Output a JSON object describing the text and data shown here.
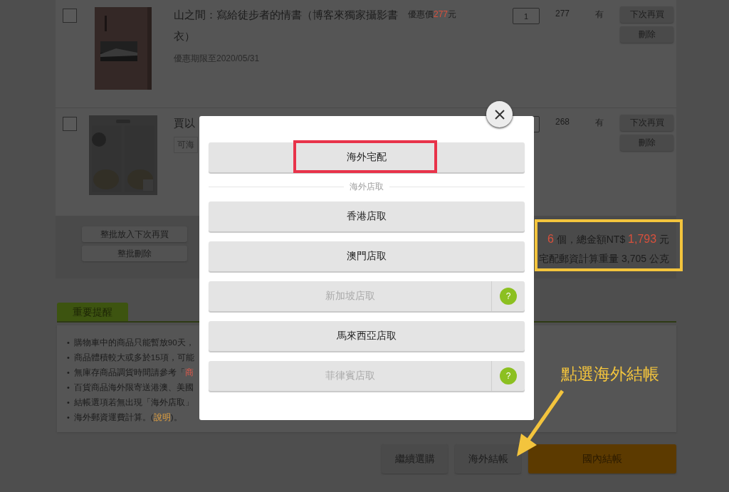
{
  "cart_items": [
    {
      "checked": false,
      "title": "山之間：寫給徒步者的情書（博客來獨家攝影書衣）",
      "note": "優惠期限至2020/05/31",
      "price_prefix": "優惠價",
      "price": "277",
      "price_suffix": "元",
      "quantity": "1",
      "subtotal": "277",
      "stock": "有",
      "actions": [
        "下次再買",
        "刪除"
      ]
    },
    {
      "checked": false,
      "title": "賈以",
      "tag": "可海",
      "subtotal": "268",
      "stock": "有",
      "actions": [
        "下次再買",
        "刪除"
      ]
    }
  ],
  "bulk_actions": [
    "整批放入下次再買",
    "整批刪除"
  ],
  "summary": {
    "line_1": [
      {
        "text": "6",
        "emphasis": true
      },
      {
        "text": " 個，總金額NT$ ",
        "emphasis": false
      },
      {
        "text": "1,793",
        "emphasis": true
      },
      {
        "text": " 元",
        "emphasis": false
      }
    ],
    "line_2": "宅配郵資計算重量 3,705 公克"
  },
  "notice": {
    "title": "重要提醒",
    "items": [
      {
        "bullet": "•",
        "parts": [
          {
            "kind": "text",
            "text": "購物車中的商品只能暫放90天，"
          }
        ]
      },
      {
        "bullet": "•",
        "parts": [
          {
            "kind": "text",
            "text": "商品體積較大或多於15項，可能"
          }
        ]
      },
      {
        "bullet": "•",
        "parts": [
          {
            "kind": "text",
            "text": "無庫存商品調貨時間請參考「"
          },
          {
            "kind": "link",
            "text": "商"
          }
        ]
      },
      {
        "bullet": "•",
        "parts": [
          {
            "kind": "text",
            "text": "百貨商品海外限寄送港澳、美國"
          }
        ]
      },
      {
        "bullet": "•",
        "parts": [
          {
            "kind": "text",
            "text": "結帳選項若無出現「海外店取」"
          }
        ]
      },
      {
        "bullet": "•",
        "parts": [
          {
            "kind": "text",
            "text": "海外郵資運費計算。("
          },
          {
            "kind": "link",
            "text": "說明"
          },
          {
            "kind": "text",
            "text": ")。"
          }
        ]
      }
    ]
  },
  "checkout_buttons": [
    {
      "label": "繼續選購",
      "kind": "secondary"
    },
    {
      "label": "海外結帳",
      "kind": "secondary"
    },
    {
      "label": "國內結帳",
      "kind": "primary"
    }
  ],
  "modal": {
    "delivery_options": [
      {
        "label": "海外宅配",
        "disabled": false
      }
    ],
    "section_label": "海外店取",
    "store_options": [
      {
        "label": "香港店取",
        "disabled": false
      },
      {
        "label": "澳門店取",
        "disabled": false
      },
      {
        "label": "新加坡店取",
        "disabled": true,
        "help": "?"
      },
      {
        "label": "馬來西亞店取",
        "disabled": false
      },
      {
        "label": "菲律賓店取",
        "disabled": true,
        "help": "?"
      }
    ]
  },
  "annotations": {
    "callout": "點選海外結帳"
  }
}
